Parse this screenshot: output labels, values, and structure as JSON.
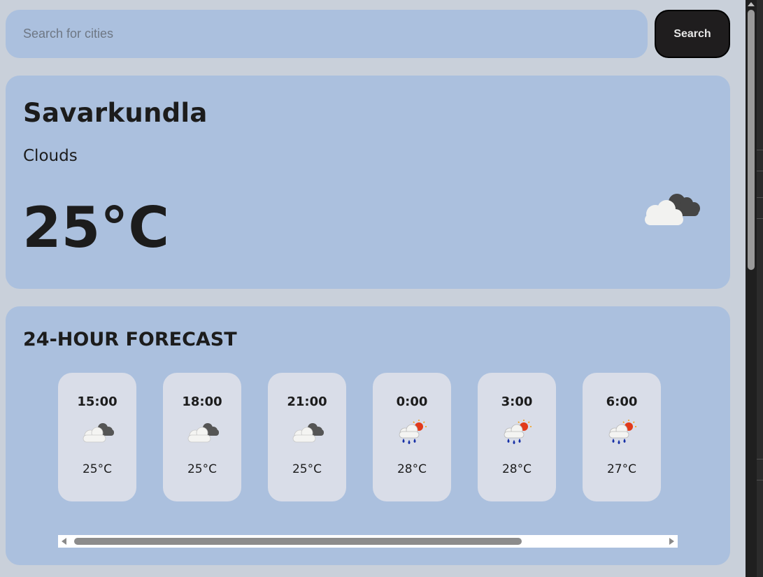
{
  "search": {
    "placeholder": "Search for cities",
    "value": "",
    "button_label": "Search"
  },
  "current": {
    "city": "Savarkundla",
    "condition": "Clouds",
    "temperature": "25°C",
    "icon": "cloud-icon"
  },
  "forecast": {
    "title": "24-HOUR FORECAST",
    "items": [
      {
        "time": "15:00",
        "icon": "cloud-icon",
        "temp": "25°C"
      },
      {
        "time": "18:00",
        "icon": "cloud-icon",
        "temp": "25°C"
      },
      {
        "time": "21:00",
        "icon": "cloud-icon",
        "temp": "25°C"
      },
      {
        "time": "0:00",
        "icon": "sun-rain-cloud-icon",
        "temp": "28°C"
      },
      {
        "time": "3:00",
        "icon": "sun-rain-cloud-icon",
        "temp": "28°C"
      },
      {
        "time": "6:00",
        "icon": "sun-rain-cloud-icon",
        "temp": "27°C"
      }
    ]
  },
  "colors": {
    "page_background": "#c9d0da",
    "card_background": "#abc0de",
    "hour_card_background": "#d9dde8",
    "button_background": "#1f1d1e"
  }
}
